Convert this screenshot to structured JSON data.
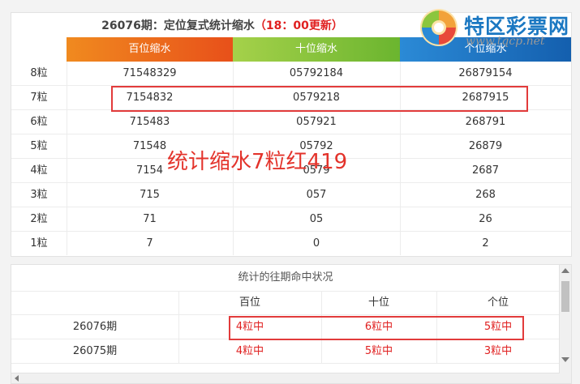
{
  "main_table": {
    "title_prefix": "26076期：定位复式统计缩水",
    "title_highlight": "（18：00更新）",
    "headers": [
      "百位缩水",
      "十位缩水",
      "个位缩水"
    ],
    "header_colors": [
      "#ec6a1a",
      "#8cc63e",
      "#1a76c5"
    ],
    "rows": [
      {
        "label": "8粒",
        "values": [
          "71548329",
          "05792184",
          "26879154"
        ]
      },
      {
        "label": "7粒",
        "values": [
          "7154832",
          "0579218",
          "2687915"
        ]
      },
      {
        "label": "6粒",
        "values": [
          "715483",
          "057921",
          "268791"
        ]
      },
      {
        "label": "5粒",
        "values": [
          "71548",
          "05792",
          "26879"
        ]
      },
      {
        "label": "4粒",
        "values": [
          "7154",
          "0579",
          "2687"
        ]
      },
      {
        "label": "3粒",
        "values": [
          "715",
          "057",
          "268"
        ]
      },
      {
        "label": "2粒",
        "values": [
          "71",
          "05",
          "26"
        ]
      },
      {
        "label": "1粒",
        "values": [
          "7",
          "0",
          "2"
        ]
      }
    ]
  },
  "overlay_text": "统计缩水7粒红419",
  "logo": {
    "name": "特区彩票网",
    "url": "www.tqcp.net"
  },
  "history_table": {
    "title": "统计的往期命中状况",
    "headers": [
      "",
      "百位",
      "十位",
      "个位"
    ],
    "rows": [
      {
        "period": "26076期",
        "values": [
          "4粒中",
          "6粒中",
          "5粒中"
        ]
      },
      {
        "period": "26075期",
        "values": [
          "4粒中",
          "5粒中",
          "3粒中"
        ]
      }
    ]
  }
}
